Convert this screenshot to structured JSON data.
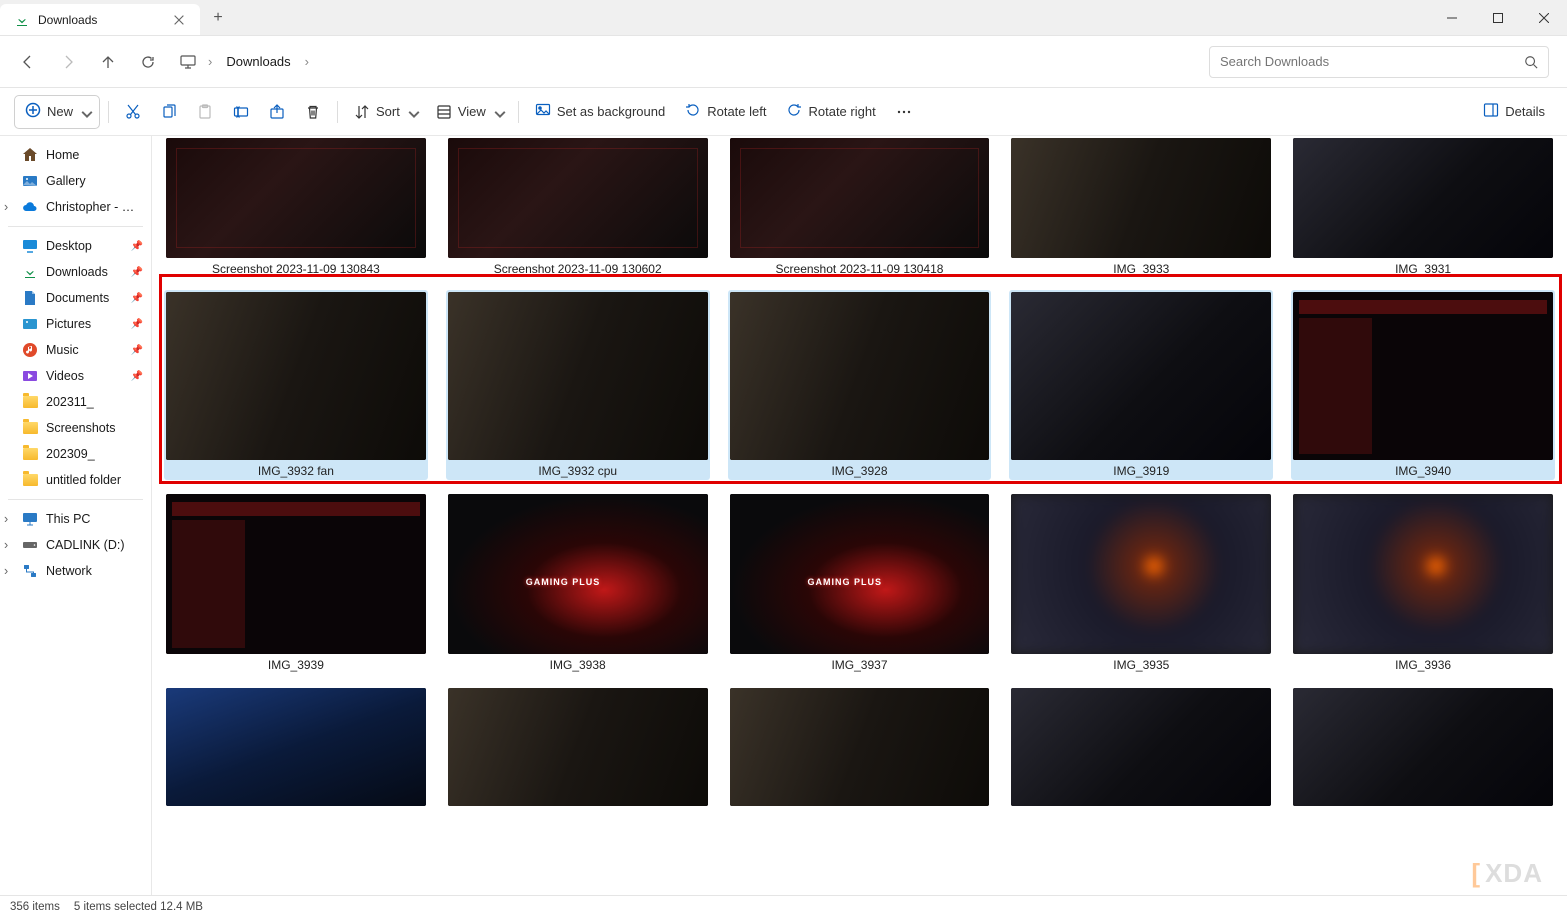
{
  "tab": {
    "title": "Downloads"
  },
  "breadcrumb": {
    "current": "Downloads"
  },
  "search": {
    "placeholder": "Search Downloads"
  },
  "toolbar": {
    "new": "New",
    "sort": "Sort",
    "view": "View",
    "set_bg": "Set as background",
    "rotate_left": "Rotate left",
    "rotate_right": "Rotate right",
    "details": "Details"
  },
  "sidebar": {
    "home": "Home",
    "gallery": "Gallery",
    "onedrive": "Christopher - Perso",
    "quick": [
      {
        "label": "Desktop",
        "pinned": true,
        "icon": "desktop"
      },
      {
        "label": "Downloads",
        "pinned": true,
        "icon": "dl"
      },
      {
        "label": "Documents",
        "pinned": true,
        "icon": "doc"
      },
      {
        "label": "Pictures",
        "pinned": true,
        "icon": "pic"
      },
      {
        "label": "Music",
        "pinned": true,
        "icon": "music"
      },
      {
        "label": "Videos",
        "pinned": true,
        "icon": "vid"
      },
      {
        "label": "202311_",
        "pinned": false,
        "icon": "folder"
      },
      {
        "label": "Screenshots",
        "pinned": false,
        "icon": "folder"
      },
      {
        "label": "202309_",
        "pinned": false,
        "icon": "folder"
      },
      {
        "label": "untitled folder",
        "pinned": false,
        "icon": "folder"
      }
    ],
    "thispc": "This PC",
    "drives": [
      "CADLINK (D:)"
    ],
    "network": "Network"
  },
  "files": {
    "row1": [
      {
        "name": "Screenshot 2023-11-09 130843",
        "style": "fake-dark"
      },
      {
        "name": "Screenshot 2023-11-09 130602",
        "style": "fake-dark"
      },
      {
        "name": "Screenshot 2023-11-09 130418",
        "style": "fake-dark"
      },
      {
        "name": "IMG_3933",
        "style": "fake-mobo"
      },
      {
        "name": "IMG_3931",
        "style": "fake-case"
      }
    ],
    "row2": [
      {
        "name": "IMG_3932 fan",
        "style": "fake-mobo",
        "selected": true
      },
      {
        "name": "IMG_3932 cpu",
        "style": "fake-mobo",
        "selected": true
      },
      {
        "name": "IMG_3928",
        "style": "fake-mobo",
        "selected": true
      },
      {
        "name": "IMG_3919",
        "style": "fake-case",
        "selected": true
      },
      {
        "name": "IMG_3940",
        "style": "fake-bios",
        "selected": true
      }
    ],
    "row3": [
      {
        "name": "IMG_3939",
        "style": "fake-bios"
      },
      {
        "name": "IMG_3938",
        "style": "fake-gaming"
      },
      {
        "name": "IMG_3937",
        "style": "fake-gaming"
      },
      {
        "name": "IMG_3935",
        "style": "fake-blur"
      },
      {
        "name": "IMG_3936",
        "style": "fake-blur"
      }
    ],
    "row4": [
      {
        "name": "",
        "style": "fake-blue"
      },
      {
        "name": "",
        "style": "fake-mobo"
      },
      {
        "name": "",
        "style": "fake-mobo"
      },
      {
        "name": "",
        "style": "fake-case"
      },
      {
        "name": "",
        "style": "fake-case"
      }
    ]
  },
  "status": {
    "total": "356 items",
    "selection": "5 items selected  12.4 MB"
  },
  "watermark": "XDA"
}
